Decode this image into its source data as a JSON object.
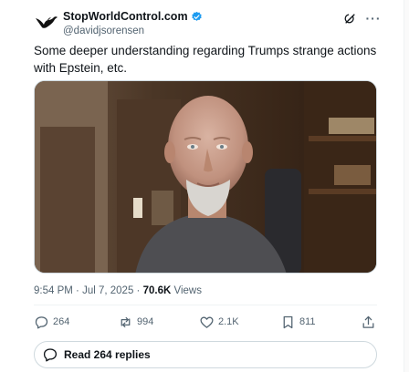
{
  "tweet": {
    "display_name": "StopWorldControl.com",
    "handle": "@davidjsorensen",
    "verified": true,
    "text": "Some deeper understanding regarding Trumps strange actions with Epstein, etc.",
    "media": {
      "type": "video",
      "description_icon": "video-thumbnail"
    },
    "time": "9:54 PM",
    "date": "Jul 7, 2025",
    "views_count": "70.6K",
    "views_label": "Views",
    "separator": "·"
  },
  "actions": {
    "replies": "264",
    "reposts": "994",
    "likes": "2.1K",
    "bookmarks": "811"
  },
  "replies_button": {
    "label": "Read 264 replies"
  },
  "colors": {
    "text": "#0f1419",
    "secondary": "#536471",
    "border": "#cfd9de",
    "verified": "#1d9bf0",
    "repost": "#536471"
  },
  "icons": {
    "avatar": "eagle-logo",
    "verified": "verified-badge-icon",
    "grok": "grok-icon",
    "more": "more-dots-icon",
    "reply": "reply-icon",
    "repost": "repost-icon",
    "like": "heart-icon",
    "bookmark": "bookmark-icon",
    "share": "share-icon"
  }
}
